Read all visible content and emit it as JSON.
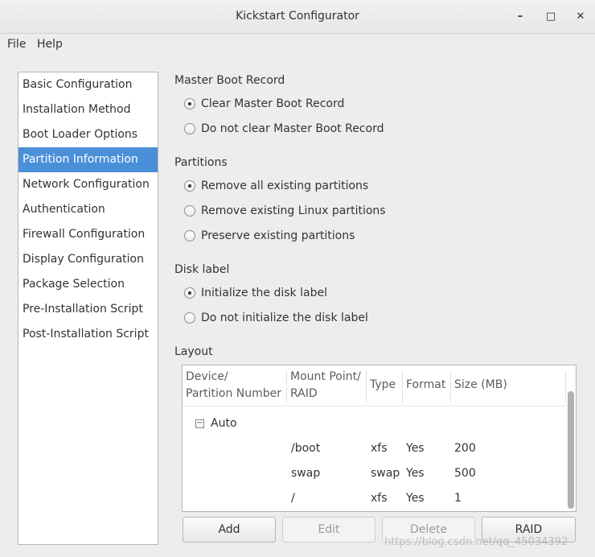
{
  "window": {
    "title": "Kickstart Configurator",
    "min_icon": "minimize-icon",
    "max_icon": "maximize-icon",
    "close_icon": "close-icon"
  },
  "menu": {
    "file": "File",
    "help": "Help"
  },
  "sidebar": {
    "items": [
      {
        "label": "Basic Configuration"
      },
      {
        "label": "Installation Method"
      },
      {
        "label": "Boot Loader Options"
      },
      {
        "label": "Partition Information"
      },
      {
        "label": "Network Configuration"
      },
      {
        "label": "Authentication"
      },
      {
        "label": "Firewall Configuration"
      },
      {
        "label": "Display Configuration"
      },
      {
        "label": "Package Selection"
      },
      {
        "label": "Pre-Installation Script"
      },
      {
        "label": "Post-Installation Script"
      }
    ],
    "selected": "Partition Information"
  },
  "mbr": {
    "title": "Master Boot Record",
    "options": [
      "Clear Master Boot Record",
      "Do not clear Master Boot Record"
    ],
    "selected": 0
  },
  "partitions": {
    "title": "Partitions",
    "options": [
      "Remove all existing partitions",
      "Remove existing Linux partitions",
      "Preserve existing partitions"
    ],
    "selected": 0
  },
  "disklabel": {
    "title": "Disk label",
    "options": [
      "Initialize the disk label",
      "Do not initialize the disk label"
    ],
    "selected": 0
  },
  "layout": {
    "title": "Layout",
    "columns": {
      "device_1": "Device/",
      "device_2": "Partition Number",
      "mount_1": "Mount Point/",
      "mount_2": "RAID",
      "type": "Type",
      "format": "Format",
      "size": "Size (MB)"
    },
    "group": "Auto",
    "expander": "−",
    "rows": [
      {
        "mount": "/boot",
        "type": "xfs",
        "format": "Yes",
        "size": "200"
      },
      {
        "mount": "swap",
        "type": "swap",
        "format": "Yes",
        "size": "500"
      },
      {
        "mount": "/",
        "type": "xfs",
        "format": "Yes",
        "size": "1"
      }
    ]
  },
  "buttons": {
    "add": "Add",
    "edit": "Edit",
    "delete": "Delete",
    "raid": "RAID"
  },
  "watermark": "https://blog.csdn.net/qq_45034392"
}
